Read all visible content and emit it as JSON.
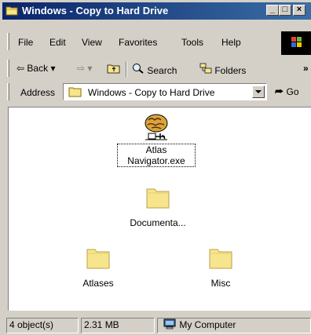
{
  "window": {
    "title": "Windows - Copy to Hard Drive",
    "controls": {
      "minimize": "_",
      "maximize": "□",
      "close": "×"
    }
  },
  "menu": {
    "items": [
      "File",
      "Edit",
      "View",
      "Favorites",
      "Tools",
      "Help"
    ]
  },
  "toolbar": {
    "back_label": "Back",
    "search_label": "Search",
    "folders_label": "Folders",
    "more": "»"
  },
  "address": {
    "label": "Address",
    "value": "Windows - Copy to Hard Drive",
    "go_label": "Go"
  },
  "content": {
    "items": [
      {
        "name": "Atlas Navigator.exe",
        "line1": "Atlas",
        "line2": "Navigator.exe",
        "type": "application",
        "icon": "brain-icon",
        "selected": true
      },
      {
        "name": "Documenta...",
        "type": "folder",
        "icon": "folder-icon"
      },
      {
        "name": "Atlases",
        "type": "folder",
        "icon": "folder-icon"
      },
      {
        "name": "Misc",
        "type": "folder",
        "icon": "folder-icon"
      }
    ]
  },
  "status": {
    "objects": "4 object(s)",
    "size": "2.31 MB",
    "zone": "My Computer"
  },
  "colors": {
    "title_active": "#0a246a",
    "title_gradient_end": "#3a6ea5",
    "face": "#d4d0c8",
    "folder": "#f7e58d"
  }
}
